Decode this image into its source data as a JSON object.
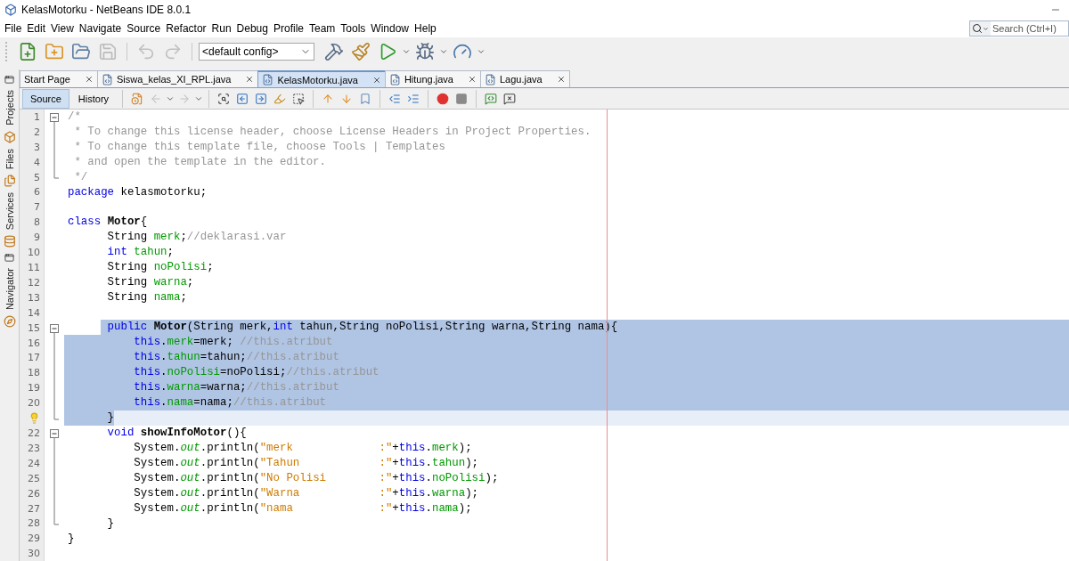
{
  "window": {
    "title": "KelasMotorku - NetBeans IDE 8.0.1"
  },
  "menu": [
    "File",
    "Edit",
    "View",
    "Navigate",
    "Source",
    "Refactor",
    "Run",
    "Debug",
    "Profile",
    "Team",
    "Tools",
    "Window",
    "Help"
  ],
  "search": {
    "placeholder": "Search (Ctrl+I)"
  },
  "toolbar": {
    "groups": [
      {
        "buttons": [
          {
            "kind": "new-file",
            "disabled": false
          },
          {
            "kind": "new-project",
            "disabled": false
          },
          {
            "kind": "open-project",
            "disabled": false
          },
          {
            "kind": "save-all",
            "disabled": true
          }
        ]
      },
      {
        "buttons": [
          {
            "kind": "undo",
            "disabled": true
          },
          {
            "kind": "redo",
            "disabled": true
          }
        ]
      }
    ],
    "config": "<default config>",
    "run_buttons": [
      {
        "kind": "build",
        "disabled": false
      },
      {
        "kind": "clean-build",
        "disabled": false
      },
      {
        "kind": "run",
        "disabled": false,
        "has_menu": true
      },
      {
        "kind": "debug",
        "disabled": false,
        "has_menu": true
      },
      {
        "kind": "profile",
        "disabled": false,
        "has_menu": true
      }
    ]
  },
  "sidebar": {
    "items": [
      {
        "label": "Projects",
        "kind": "projects"
      },
      {
        "label": "Files",
        "kind": "files"
      },
      {
        "label": "Services",
        "kind": "services"
      },
      {
        "label": "Navigator",
        "kind": "navigator"
      }
    ]
  },
  "tabs": [
    {
      "label": "Start Page",
      "kind": "page",
      "selected": false
    },
    {
      "label": "Siswa_kelas_XI_RPL.java",
      "kind": "java",
      "selected": false
    },
    {
      "label": "KelasMotorku.java",
      "kind": "java",
      "selected": true
    },
    {
      "label": "Hitung.java",
      "kind": "java",
      "selected": false
    },
    {
      "label": "Lagu.java",
      "kind": "java",
      "selected": false
    }
  ],
  "editor_tabs": [
    {
      "label": "Source",
      "selected": true
    },
    {
      "label": "History",
      "selected": false
    }
  ],
  "editor_toolbar": {
    "groups": [
      {
        "buttons": [
          {
            "kind": "last-edit",
            "disabled": false
          },
          {
            "kind": "back",
            "disabled": true,
            "has_menu": true
          },
          {
            "kind": "forward",
            "disabled": true,
            "has_menu": true
          }
        ]
      },
      {
        "buttons": [
          {
            "kind": "find-selection",
            "disabled": false
          },
          {
            "kind": "find-previous",
            "disabled": false
          },
          {
            "kind": "find-next",
            "disabled": false
          },
          {
            "kind": "toggle-highlight",
            "disabled": false
          },
          {
            "kind": "rect-select",
            "disabled": false
          }
        ]
      },
      {
        "buttons": [
          {
            "kind": "previous-bookmark",
            "disabled": false
          },
          {
            "kind": "next-bookmark",
            "disabled": false
          },
          {
            "kind": "toggle-bookmark",
            "disabled": false
          }
        ]
      },
      {
        "buttons": [
          {
            "kind": "shift-left",
            "disabled": false
          },
          {
            "kind": "shift-right",
            "disabled": false
          }
        ]
      },
      {
        "buttons": [
          {
            "kind": "start-macro",
            "disabled": false
          },
          {
            "kind": "stop-macro",
            "disabled": false
          }
        ]
      },
      {
        "buttons": [
          {
            "kind": "comment",
            "disabled": false
          },
          {
            "kind": "uncomment",
            "disabled": false
          }
        ]
      }
    ]
  },
  "lines": [
    {
      "number": "1",
      "fold_start": true,
      "selected": false,
      "tokens": [
        {
          "kind": "comment",
          "text": "/*"
        }
      ]
    },
    {
      "number": "2",
      "selected": false,
      "tokens": [
        {
          "kind": "comment",
          "text": " * To change this license header, choose License Headers in Project Properties."
        }
      ]
    },
    {
      "number": "3",
      "selected": false,
      "tokens": [
        {
          "kind": "comment",
          "text": " * To change this template file, choose Tools | Templates"
        }
      ]
    },
    {
      "number": "4",
      "selected": false,
      "tokens": [
        {
          "kind": "comment",
          "text": " * and open the template in the editor."
        }
      ]
    },
    {
      "number": "5",
      "fold_end": true,
      "selected": false,
      "tokens": [
        {
          "kind": "comment",
          "text": " */"
        }
      ]
    },
    {
      "number": "6",
      "selected": false,
      "tokens": [
        {
          "kind": "keyword",
          "text": "package"
        },
        {
          "kind": "plain",
          "text": " kelasmotorku;"
        }
      ]
    },
    {
      "number": "7",
      "selected": false
    },
    {
      "number": "8",
      "selected": false,
      "tokens": [
        {
          "kind": "keyword",
          "text": "class "
        },
        {
          "kind": "bold",
          "text": "Motor"
        },
        {
          "kind": "plain",
          "text": "{"
        }
      ]
    },
    {
      "number": "9",
      "selected": false,
      "tokens": [
        {
          "kind": "plain",
          "text": "      String "
        },
        {
          "kind": "field",
          "text": "merk"
        },
        {
          "kind": "plain",
          "text": ";"
        },
        {
          "kind": "comment",
          "text": "//deklarasi.var"
        }
      ]
    },
    {
      "number": "10",
      "selected": false,
      "tokens": [
        {
          "kind": "keyword",
          "text": "      int "
        },
        {
          "kind": "field",
          "text": "tahun"
        },
        {
          "kind": "plain",
          "text": ";"
        }
      ]
    },
    {
      "number": "11",
      "selected": false,
      "tokens": [
        {
          "kind": "plain",
          "text": "      String "
        },
        {
          "kind": "field",
          "text": "noPolisi"
        },
        {
          "kind": "plain",
          "text": ";"
        }
      ]
    },
    {
      "number": "12",
      "selected": false,
      "tokens": [
        {
          "kind": "plain",
          "text": "      String "
        },
        {
          "kind": "field",
          "text": "warna"
        },
        {
          "kind": "plain",
          "text": ";"
        }
      ]
    },
    {
      "number": "13",
      "selected": false,
      "tokens": [
        {
          "kind": "plain",
          "text": "      String "
        },
        {
          "kind": "field",
          "text": "nama"
        },
        {
          "kind": "plain",
          "text": ";"
        }
      ]
    },
    {
      "number": "14",
      "selected": false
    },
    {
      "number": "15",
      "fold_start": true,
      "selected": true,
      "selection_from_indent": true,
      "tokens": [
        {
          "kind": "keyword",
          "text": "      public "
        },
        {
          "kind": "bold",
          "text": "Motor"
        },
        {
          "kind": "plain",
          "text": "(String merk,"
        },
        {
          "kind": "keyword",
          "text": "int"
        },
        {
          "kind": "plain",
          "text": " tahun,String noPolisi,String warna,String nama){"
        }
      ]
    },
    {
      "number": "16",
      "selected": true,
      "tokens": [
        {
          "kind": "keyword",
          "text": "          this"
        },
        {
          "kind": "plain",
          "text": "."
        },
        {
          "kind": "field",
          "text": "merk"
        },
        {
          "kind": "plain",
          "text": "=merk; "
        },
        {
          "kind": "comment",
          "text": "//this.atribut"
        }
      ]
    },
    {
      "number": "17",
      "selected": true,
      "tokens": [
        {
          "kind": "keyword",
          "text": "          this"
        },
        {
          "kind": "plain",
          "text": "."
        },
        {
          "kind": "field",
          "text": "tahun"
        },
        {
          "kind": "plain",
          "text": "=tahun;"
        },
        {
          "kind": "comment",
          "text": "//this.atribut"
        }
      ]
    },
    {
      "number": "18",
      "selected": true,
      "tokens": [
        {
          "kind": "keyword",
          "text": "          this"
        },
        {
          "kind": "plain",
          "text": "."
        },
        {
          "kind": "field",
          "text": "noPolisi"
        },
        {
          "kind": "plain",
          "text": "=noPolisi;"
        },
        {
          "kind": "comment",
          "text": "//this.atribut"
        }
      ]
    },
    {
      "number": "19",
      "selected": true,
      "tokens": [
        {
          "kind": "keyword",
          "text": "          this"
        },
        {
          "kind": "plain",
          "text": "."
        },
        {
          "kind": "field",
          "text": "warna"
        },
        {
          "kind": "plain",
          "text": "=warna;"
        },
        {
          "kind": "comment",
          "text": "//this.atribut"
        }
      ]
    },
    {
      "number": "20",
      "selected": true,
      "tokens": [
        {
          "kind": "keyword",
          "text": "          this"
        },
        {
          "kind": "plain",
          "text": "."
        },
        {
          "kind": "field",
          "text": "nama"
        },
        {
          "kind": "plain",
          "text": "=nama;"
        },
        {
          "kind": "comment",
          "text": "//this.atribut"
        }
      ]
    },
    {
      "hint": true,
      "fold_end": true,
      "selected": true,
      "selection_to_caret": true,
      "current": true,
      "tokens": [
        {
          "kind": "plain",
          "text": "      }"
        }
      ]
    },
    {
      "number": "22",
      "fold_start": true,
      "selected": false,
      "tokens": [
        {
          "kind": "keyword",
          "text": "      void "
        },
        {
          "kind": "bold",
          "text": "showInfoMotor"
        },
        {
          "kind": "plain",
          "text": "(){"
        }
      ]
    },
    {
      "number": "23",
      "selected": false,
      "tokens": [
        {
          "kind": "plain",
          "text": "          System."
        },
        {
          "kind": "static",
          "text": "out"
        },
        {
          "kind": "plain",
          "text": ".println("
        },
        {
          "kind": "string",
          "text": "\"merk             :\""
        },
        {
          "kind": "plain",
          "text": "+"
        },
        {
          "kind": "keyword",
          "text": "this"
        },
        {
          "kind": "plain",
          "text": "."
        },
        {
          "kind": "field",
          "text": "merk"
        },
        {
          "kind": "plain",
          "text": ");"
        }
      ]
    },
    {
      "number": "24",
      "selected": false,
      "tokens": [
        {
          "kind": "plain",
          "text": "          System."
        },
        {
          "kind": "static",
          "text": "out"
        },
        {
          "kind": "plain",
          "text": ".println("
        },
        {
          "kind": "string",
          "text": "\"Tahun            :\""
        },
        {
          "kind": "plain",
          "text": "+"
        },
        {
          "kind": "keyword",
          "text": "this"
        },
        {
          "kind": "plain",
          "text": "."
        },
        {
          "kind": "field",
          "text": "tahun"
        },
        {
          "kind": "plain",
          "text": ");"
        }
      ]
    },
    {
      "number": "25",
      "selected": false,
      "tokens": [
        {
          "kind": "plain",
          "text": "          System."
        },
        {
          "kind": "static",
          "text": "out"
        },
        {
          "kind": "plain",
          "text": ".println("
        },
        {
          "kind": "string",
          "text": "\"No Polisi        :\""
        },
        {
          "kind": "plain",
          "text": "+"
        },
        {
          "kind": "keyword",
          "text": "this"
        },
        {
          "kind": "plain",
          "text": "."
        },
        {
          "kind": "field",
          "text": "noPolisi"
        },
        {
          "kind": "plain",
          "text": ");"
        }
      ]
    },
    {
      "number": "26",
      "selected": false,
      "tokens": [
        {
          "kind": "plain",
          "text": "          System."
        },
        {
          "kind": "static",
          "text": "out"
        },
        {
          "kind": "plain",
          "text": ".println("
        },
        {
          "kind": "string",
          "text": "\"Warna            :\""
        },
        {
          "kind": "plain",
          "text": "+"
        },
        {
          "kind": "keyword",
          "text": "this"
        },
        {
          "kind": "plain",
          "text": "."
        },
        {
          "kind": "field",
          "text": "warna"
        },
        {
          "kind": "plain",
          "text": ");"
        }
      ]
    },
    {
      "number": "27",
      "selected": false,
      "tokens": [
        {
          "kind": "plain",
          "text": "          System."
        },
        {
          "kind": "static",
          "text": "out"
        },
        {
          "kind": "plain",
          "text": ".println("
        },
        {
          "kind": "string",
          "text": "\"nama             :\""
        },
        {
          "kind": "plain",
          "text": "+"
        },
        {
          "kind": "keyword",
          "text": "this"
        },
        {
          "kind": "plain",
          "text": "."
        },
        {
          "kind": "field",
          "text": "nama"
        },
        {
          "kind": "plain",
          "text": ");"
        }
      ]
    },
    {
      "number": "28",
      "fold_end": true,
      "selected": false,
      "tokens": [
        {
          "kind": "plain",
          "text": "      }"
        }
      ]
    },
    {
      "number": "29",
      "selected": false,
      "tokens": [
        {
          "kind": "plain",
          "text": "}"
        }
      ]
    },
    {
      "number": "30",
      "selected": false
    }
  ]
}
